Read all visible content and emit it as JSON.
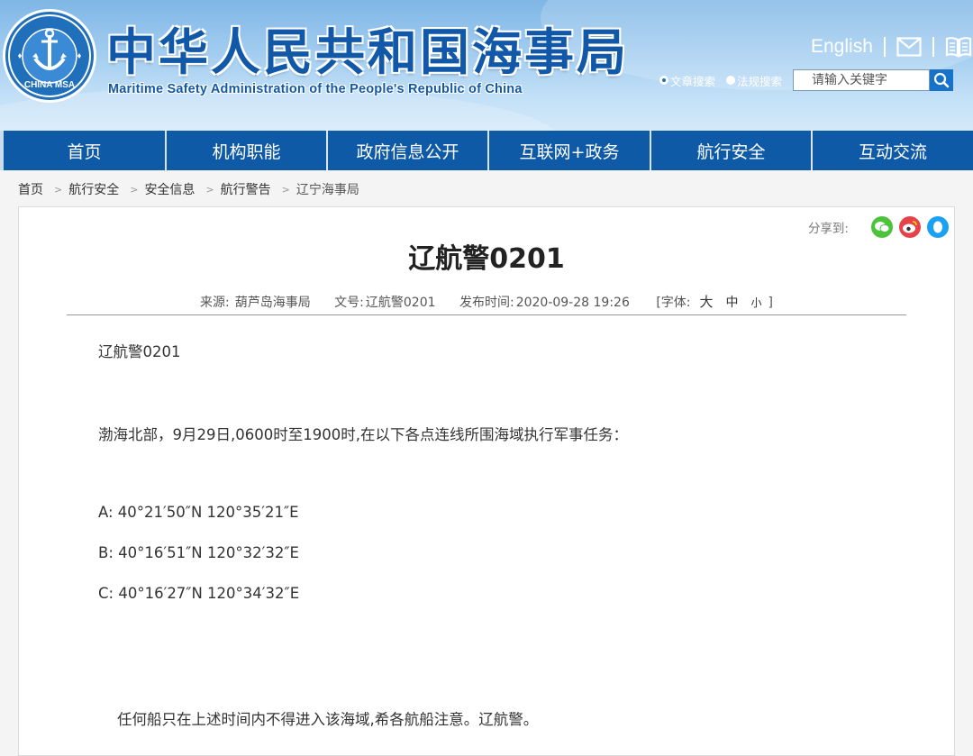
{
  "header": {
    "logo_alt": "CHINA MSA",
    "title": "中华人民共和国海事局",
    "subtitle": "Maritime Safety Administration of the People's Republic of China",
    "english_link": "English",
    "mail_icon": "mail-icon",
    "book_icon": "book-icon"
  },
  "search": {
    "options": [
      {
        "label": "文章搜索",
        "selected": true
      },
      {
        "label": "法规搜索",
        "selected": false
      }
    ],
    "placeholder": "请输入关键字",
    "button_icon": "search-icon"
  },
  "nav": {
    "items": [
      "首页",
      "机构职能",
      "政府信息公开",
      "互联网+政务",
      "航行安全",
      "互动交流"
    ]
  },
  "breadcrumb": [
    "首页",
    "航行安全",
    "安全信息",
    "航行警告",
    "辽宁海事局"
  ],
  "article": {
    "share_label": "分享到:",
    "share_icons": [
      "wechat-icon",
      "weibo-icon",
      "qq-icon"
    ],
    "title": "辽航警0201",
    "meta": {
      "source_label": "来源:",
      "source": "葫芦岛海事局",
      "doc_label": "文号:",
      "doc_no": "辽航警0201",
      "time_label": "发布时间:",
      "time": "2020-09-28 19:26",
      "font_label": "[字体:",
      "font_large": "大",
      "font_medium": "中",
      "font_small": "小",
      "font_close": "]"
    },
    "paragraphs": {
      "p1": "辽航警0201",
      "p2": "渤海北部，9月29日,0600时至1900时,在以下各点连线所围海域执行军事任务：",
      "point_a": "A: 40°21′50″N 120°35′21″E",
      "point_b": "B: 40°16′51″N 120°32′32″E",
      "point_c": "C: 40°16′27″N 120°34′32″E",
      "p_end": "任何船只在上述时间内不得进入该海域,希各航船注意。辽航警。"
    }
  },
  "colors": {
    "brand_blue": "#0e5aa6",
    "title_blue": "#1159a8",
    "wechat": "#4bc43c",
    "weibo": "#e6424a",
    "qq": "#1aa1f1"
  }
}
